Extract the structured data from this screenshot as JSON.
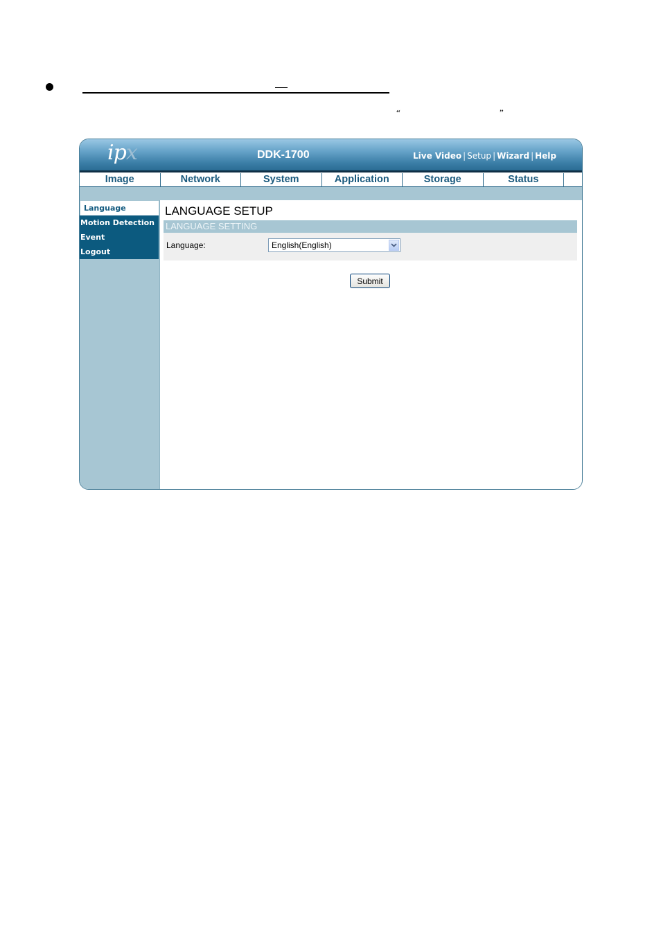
{
  "document": {
    "open_quote": "“",
    "close_quote": "”"
  },
  "app": {
    "logo_main": "ip",
    "logo_accent": "x",
    "model": "DDK-1700",
    "top_links": [
      {
        "label": "Live Video",
        "bold": true
      },
      {
        "label": "Setup",
        "bold": false
      },
      {
        "label": "Wizard",
        "bold": true
      },
      {
        "label": "Help",
        "bold": true
      }
    ],
    "top_link_separator": "|"
  },
  "nav": {
    "tabs": [
      "Image",
      "Network",
      "System",
      "Application",
      "Storage",
      "Status"
    ]
  },
  "sidebar": {
    "items": [
      {
        "label": "Language",
        "active": true
      },
      {
        "label": "Motion Detection",
        "active": false
      },
      {
        "label": "Event",
        "active": false
      },
      {
        "label": "Logout",
        "active": false
      }
    ]
  },
  "main": {
    "title": "LANGUAGE SETUP",
    "section_title": "LANGUAGE SETTING",
    "language_label": "Language:",
    "language_value": "English(English)",
    "submit_label": "Submit"
  },
  "colors": {
    "nav_text": "#19597d",
    "sidebar_item_bg": "#0c5a7f",
    "panel_bg": "#a7c6d3"
  }
}
